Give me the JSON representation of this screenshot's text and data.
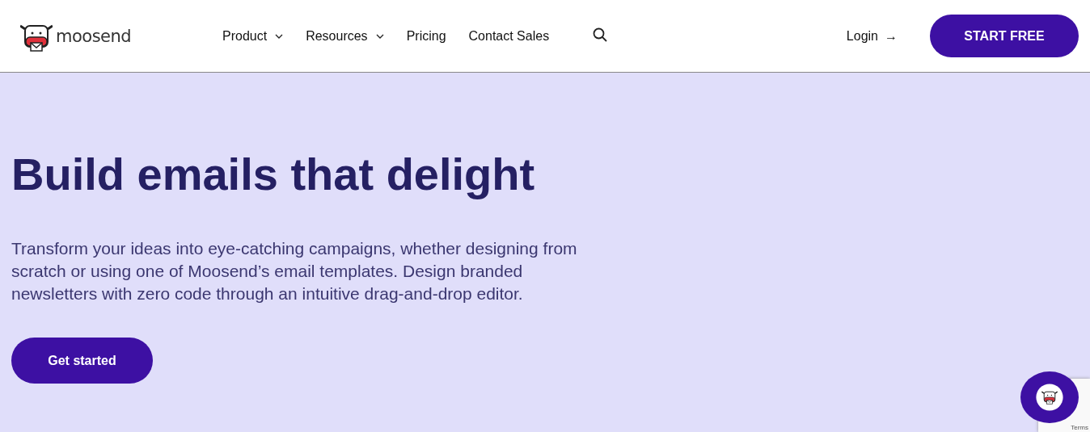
{
  "header": {
    "logo": "moosend",
    "nav": [
      {
        "label": "Product",
        "dropdown": true
      },
      {
        "label": "Resources",
        "dropdown": true
      },
      {
        "label": "Pricing",
        "dropdown": false
      },
      {
        "label": "Contact Sales",
        "dropdown": false
      }
    ],
    "login": "Login",
    "login_arrow": "→",
    "cta": "START FREE"
  },
  "hero": {
    "title": "Build emails that delight",
    "text": "Transform your ideas into eye-catching campaigns, whether designing from scratch or using one of Moosend’s email templates. Design branded newsletters with zero code through an intuitive drag-and-drop editor.",
    "button": "Get started"
  },
  "recaptcha": {
    "text": "Terms"
  }
}
